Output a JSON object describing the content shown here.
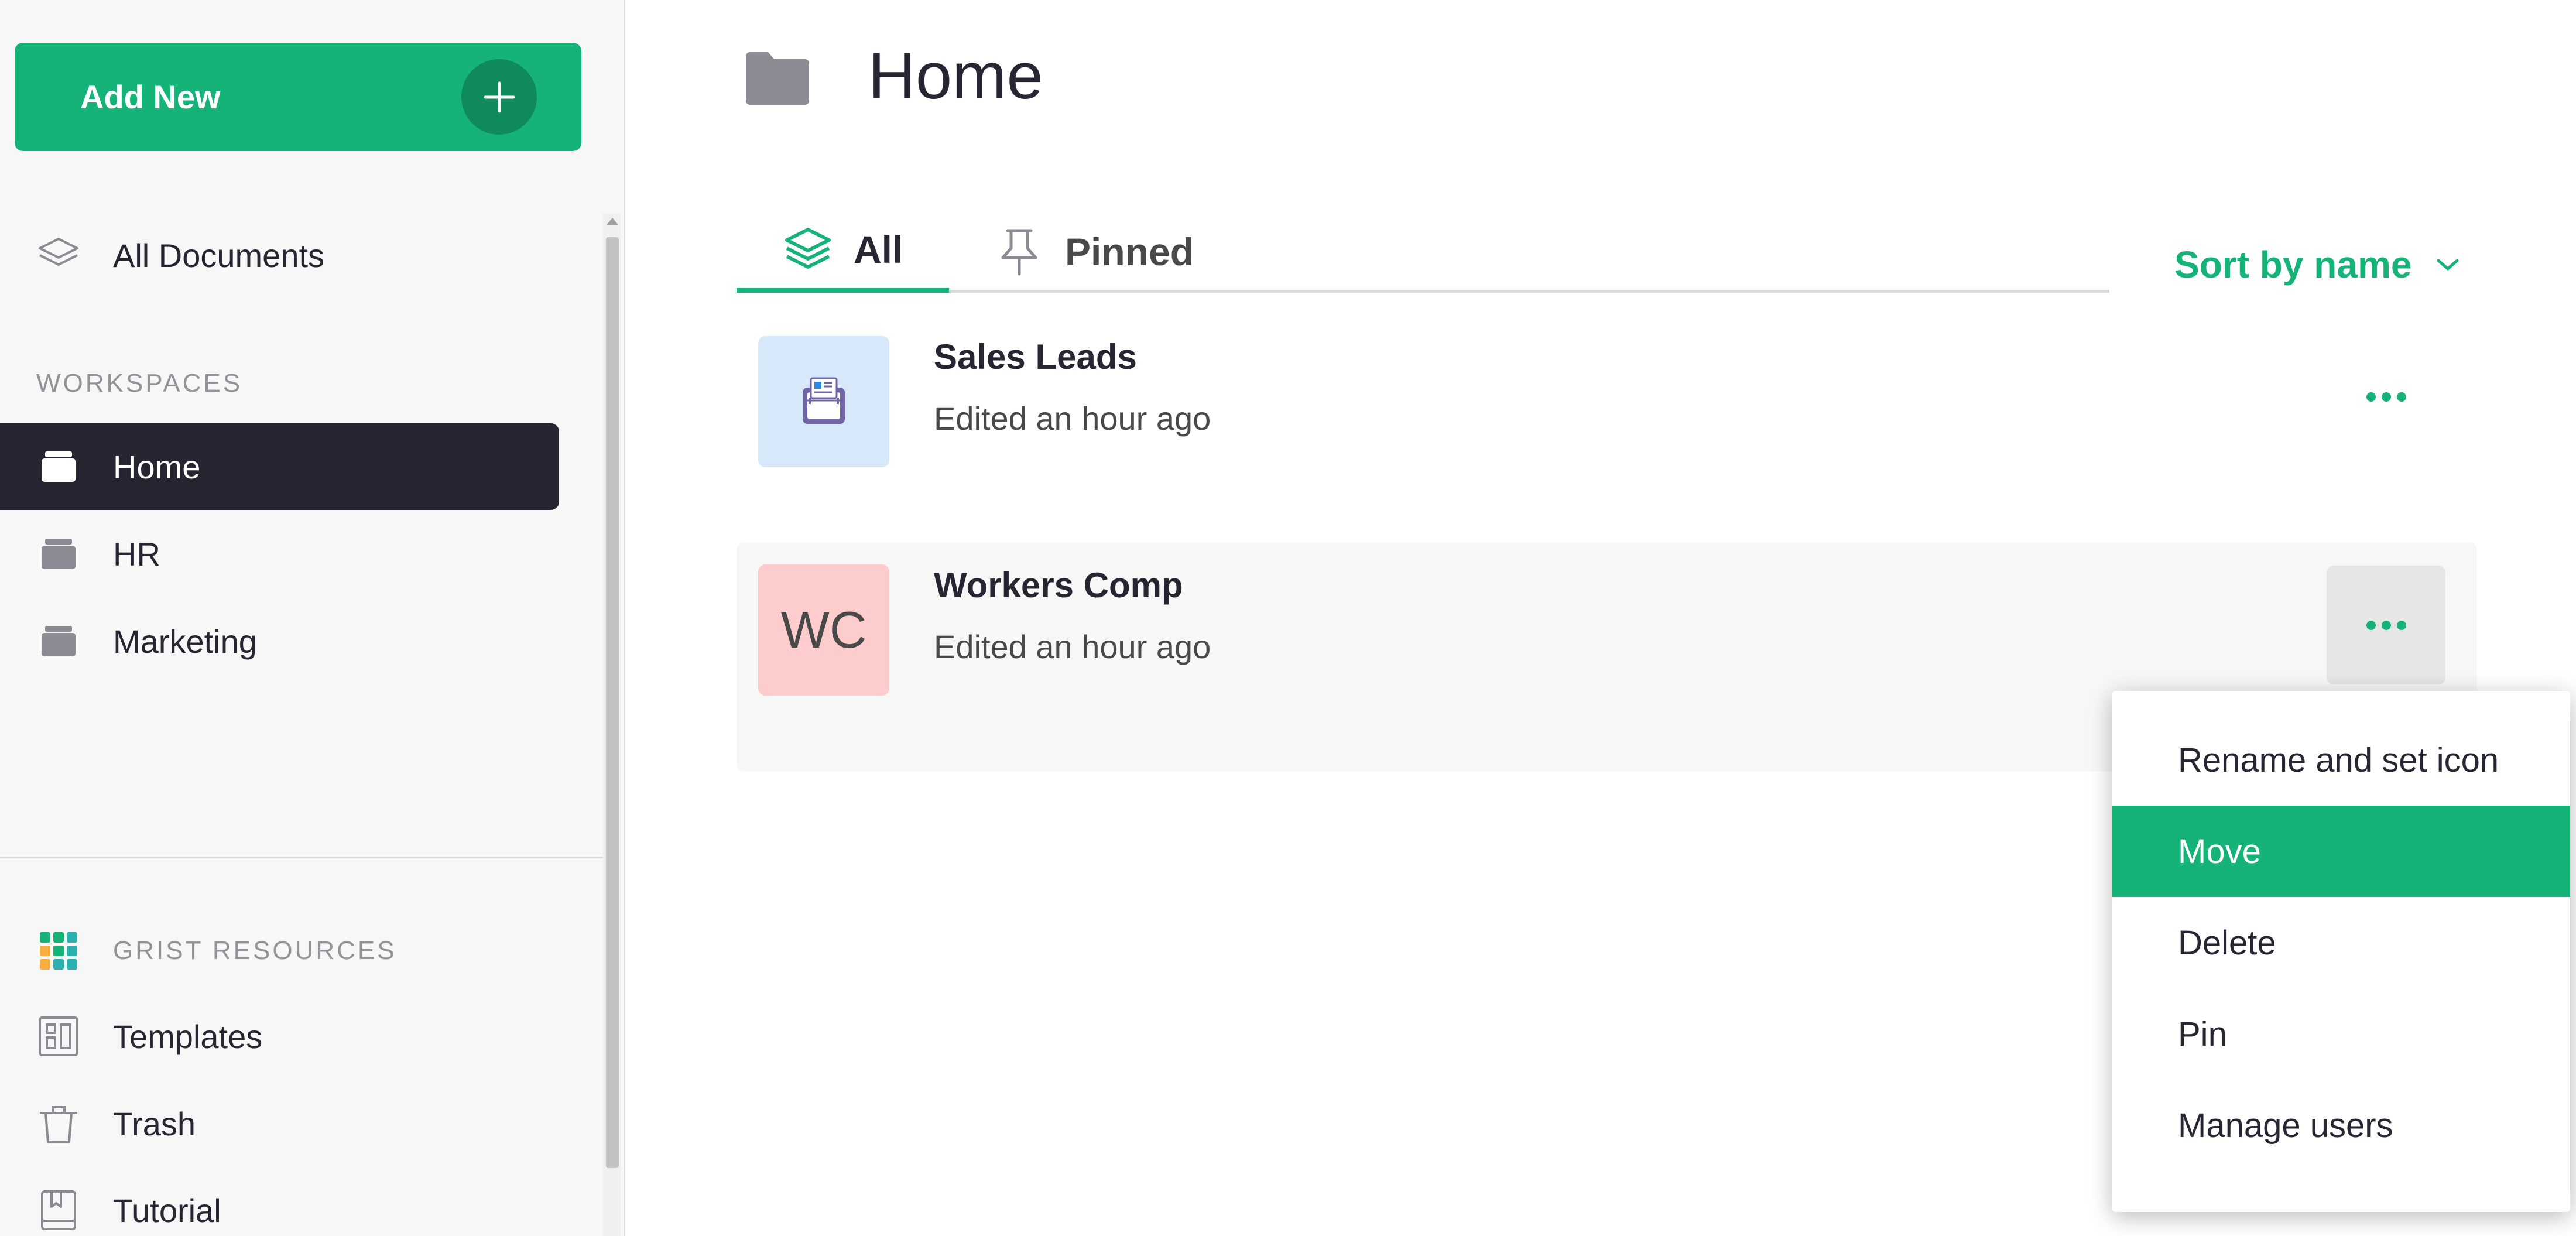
{
  "sidebar": {
    "add_new_label": "Add New",
    "all_documents_label": "All Documents",
    "workspaces_heading": "WORKSPACES",
    "workspaces": [
      {
        "label": "Home"
      },
      {
        "label": "HR"
      },
      {
        "label": "Marketing"
      }
    ],
    "resources_heading": "GRIST RESOURCES",
    "resources": [
      {
        "label": "Templates"
      },
      {
        "label": "Trash"
      },
      {
        "label": "Tutorial"
      }
    ]
  },
  "header": {
    "title": "Home"
  },
  "tabs": [
    {
      "label": "All"
    },
    {
      "label": "Pinned"
    }
  ],
  "sort": {
    "label": "Sort by name"
  },
  "documents": [
    {
      "name": "Sales Leads",
      "edited": "Edited an hour ago",
      "thumb_color": "#d8e8fb"
    },
    {
      "name": "Workers Comp",
      "edited": "Edited an hour ago",
      "initials": "WC",
      "thumb_color": "#fdcccc"
    }
  ],
  "context_menu": {
    "items": [
      {
        "label": "Rename and set icon"
      },
      {
        "label": "Move"
      },
      {
        "label": "Delete"
      },
      {
        "label": "Pin"
      },
      {
        "label": "Manage users"
      }
    ],
    "selected": "Move"
  },
  "colors": {
    "accent": "#16b378",
    "dark": "#262633",
    "muted": "#929299"
  }
}
